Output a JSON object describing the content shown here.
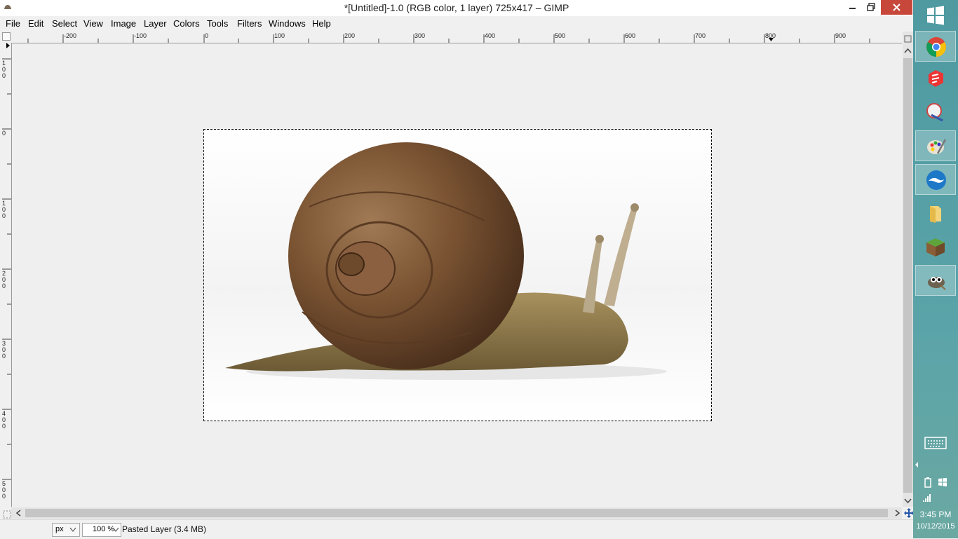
{
  "window": {
    "title": "*[Untitled]-1.0 (RGB color, 1 layer) 725x417 – GIMP"
  },
  "menu": [
    "File",
    "Edit",
    "Select",
    "View",
    "Image",
    "Layer",
    "Colors",
    "Tools",
    "Filters",
    "Windows",
    "Help"
  ],
  "rulers": {
    "horizontal": [
      "-200",
      "-100",
      "0",
      "100",
      "200",
      "300",
      "400",
      "500",
      "600",
      "700",
      "800",
      "900"
    ],
    "vertical": [
      "100",
      "0",
      "100",
      "200",
      "300",
      "400",
      "500"
    ]
  },
  "statusbar": {
    "unit": "px",
    "zoom": "100 %",
    "message": "Pasted Layer (3.4 MB)"
  },
  "taskbar": {
    "apps": [
      "windows-start",
      "chrome",
      "sketchup",
      "paint-tool",
      "paint-palette",
      "openoffice",
      "file-explorer",
      "minecraft",
      "gimp"
    ],
    "time": "3:45 PM",
    "date": "10/12/2015"
  },
  "colors": {
    "close_button": "#c7483b",
    "taskbar": "#4e9aa0"
  }
}
